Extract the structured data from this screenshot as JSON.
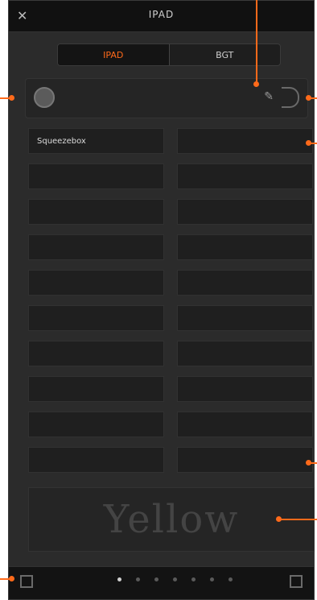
{
  "header": {
    "title": "IPAD",
    "close_icon": "close-icon"
  },
  "segments": [
    {
      "label": "IPAD",
      "active": true
    },
    {
      "label": "BGT",
      "active": false
    }
  ],
  "toolbar": {
    "left_icon": "record-icon",
    "edit_icon": "pencil-icon",
    "right_icon": "bracket-icon"
  },
  "grid": {
    "first_cell_label": "Squeezebox"
  },
  "bottom": {
    "page_count": 7,
    "active_page": 1,
    "left_icon": "square-icon",
    "right_icon": "square-icon"
  },
  "colors": {
    "accent": "#ff6a1a",
    "background": "#2b2b2b"
  }
}
